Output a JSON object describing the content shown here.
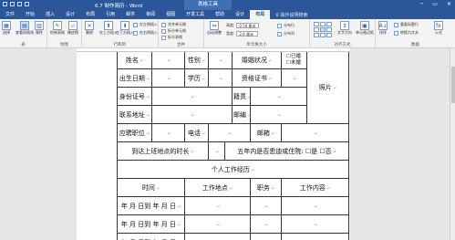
{
  "app": {
    "title": "6.7 制作简历 - Word",
    "context": "表格工具"
  },
  "window_controls": [
    "─",
    "▭",
    "✕"
  ],
  "tabs": [
    "文件",
    "开始",
    "插入",
    "设计",
    "布局",
    "引用",
    "邮件",
    "审阅",
    "视图",
    "开发工具",
    "帮助",
    "设计",
    "布局"
  ],
  "tell_me": "♀ 操作说明搜索",
  "ribbon": {
    "g1": {
      "label": "表",
      "b1": "选择",
      "b2": "查看网格线",
      "b3": "属性"
    },
    "g2": {
      "label": "绘图",
      "b1": "绘制表格",
      "b2": "橡皮擦"
    },
    "g3": {
      "label": "行和列",
      "b1": "删除",
      "b2": "在上方插入",
      "b3": "在下方插入",
      "b4": "在左侧插入",
      "b5": "在右侧插入"
    },
    "g4": {
      "label": "合并",
      "b1": "合并单元格",
      "b2": "拆分单元格",
      "b3": "拆分表格"
    },
    "g5": {
      "label": "单元格大小",
      "b1": "自动调整",
      "h_label": "高度:",
      "h_value": "0.56 厘米",
      "w_label": "宽度:",
      "w_value": "2.6 厘米",
      "s1": "分布行",
      "s2": "分布列"
    },
    "g6": {
      "label": "对齐方式",
      "b1": "文字方向",
      "b2": "单元格边距"
    },
    "g7": {
      "label": "数据",
      "b1": "排序",
      "b2": "重复标题行",
      "b3": "转换为文本",
      "b4": "公式"
    }
  },
  "form": {
    "mark": "↵",
    "r1": {
      "name": "姓名",
      "gender": "性别",
      "marital": "婚姻状况",
      "opt1": "☐已婚",
      "opt2": "☐未婚",
      "photo": "照片"
    },
    "r2": {
      "birth": "出生日期",
      "edu": "学历",
      "cert": "资格证书"
    },
    "r3": {
      "id": "身份证号",
      "origin": "籍贯"
    },
    "r4": {
      "addr": "联系地址",
      "zip": "邮编"
    },
    "r5": {
      "pos": "应聘职位",
      "phone": "电话",
      "email": "邮箱"
    },
    "r6": {
      "arrive": "到达上班地点的时长",
      "stay": "五年内是否患迪或住院:",
      "yes": "☐是",
      "no": "☐否"
    },
    "r7": {
      "section": "个人工作经历"
    },
    "r8": {
      "time": "时间",
      "place": "工作地点",
      "title": "职务",
      "content": "工作内容"
    },
    "period": "年 月 日到 年 月 日"
  }
}
